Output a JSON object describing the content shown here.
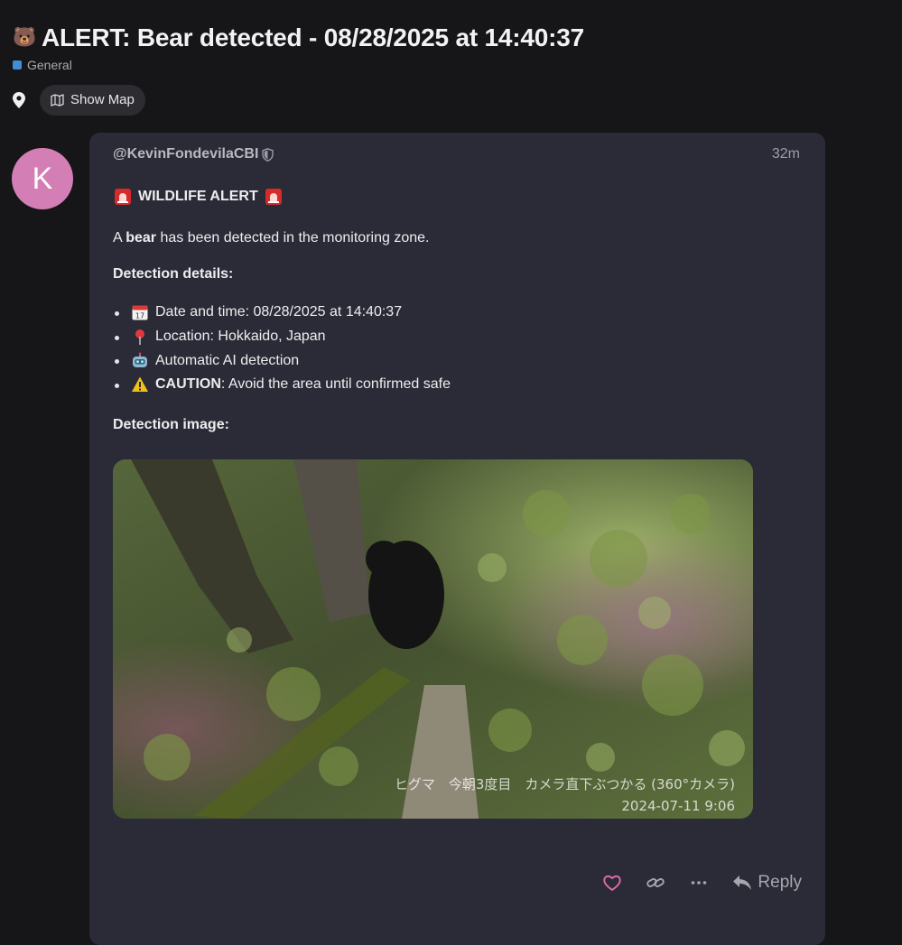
{
  "topic": {
    "emoji": "🐻",
    "title": "ALERT: Bear detected - 08/28/2025 at 14:40:37",
    "category": "General",
    "category_color": "#3e8fd6",
    "map_button": "Show Map"
  },
  "post": {
    "avatar_letter": "K",
    "avatar_color": "#d37fb5",
    "username": "@KevinFondevilaCBI",
    "time": "32m",
    "alert_heading": "WILDLIFE ALERT",
    "intro_prefix": "A ",
    "intro_bold": "bear",
    "intro_suffix": " has been detected in the monitoring zone.",
    "details_heading": "Detection details:",
    "details": {
      "date_text": "Date and time: 08/28/2025 at 14:40:37",
      "location_text": "Location: Hokkaido, Japan",
      "ai_text": "Automatic AI detection",
      "caution_bold": "CAUTION",
      "caution_text": ": Avoid the area until confirmed safe"
    },
    "image_heading": "Detection image:",
    "photo_caption": "ヒグマ　今朝3度目　カメラ直下ぶつかる (360°カメラ)",
    "photo_timestamp": "2024-07-11 9:06"
  },
  "actions": {
    "reply_label": "Reply"
  }
}
